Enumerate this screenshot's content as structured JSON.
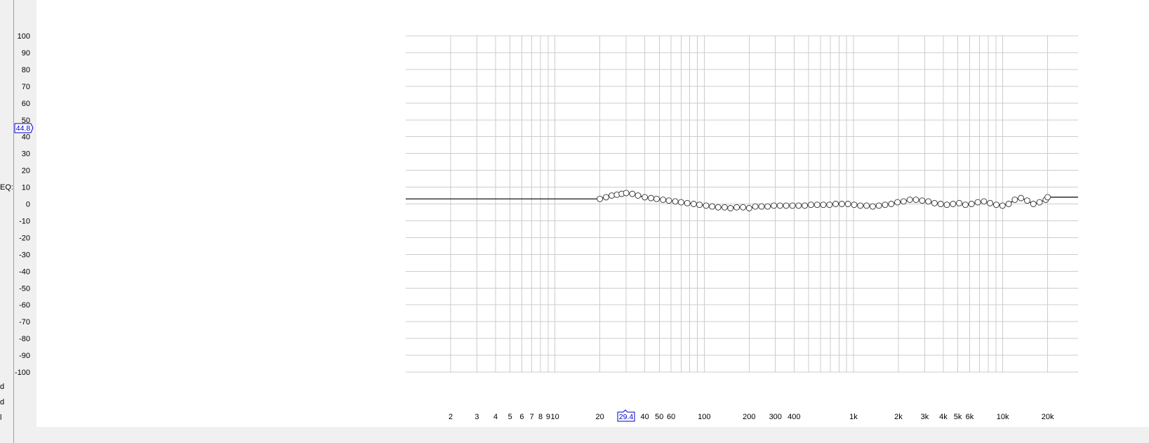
{
  "window": {
    "eq_label": "EQ:",
    "side_labels": [
      "d",
      "d",
      "l"
    ]
  },
  "cursor": {
    "y_readout": "44.8",
    "x_readout": "29.4"
  },
  "colors": {
    "grid": "#cccccc",
    "curve": "#000000",
    "readout_text": "#0000cc",
    "background": "#ffffff"
  },
  "chart_data": {
    "type": "line",
    "x_scale": "log",
    "xlim": [
      1,
      32000
    ],
    "ylim": [
      -100,
      100
    ],
    "y_ticks": [
      100,
      90,
      80,
      70,
      60,
      50,
      40,
      30,
      20,
      10,
      0,
      -10,
      -20,
      -30,
      -40,
      -50,
      -60,
      -70,
      -80,
      -90,
      -100
    ],
    "y_tick_labels": [
      "100",
      "90",
      "80",
      "70",
      "60",
      "50",
      "40",
      "30",
      "20",
      "10",
      "0",
      "-10",
      "-20",
      "-30",
      "-40",
      "-50",
      "-60",
      "-70",
      "-80",
      "-90",
      "-100"
    ],
    "x_ticks": [
      2,
      3,
      4,
      5,
      6,
      7,
      8,
      9,
      10,
      20,
      40,
      50,
      60,
      100,
      200,
      300,
      400,
      1000,
      2000,
      3000,
      4000,
      5000,
      6000,
      10000,
      20000
    ],
    "x_tick_labels": [
      "2",
      "3",
      "4",
      "5",
      "6",
      "7",
      "8",
      "9",
      "10",
      "20",
      "40",
      "50",
      "60",
      "100",
      "200",
      "300",
      "400",
      "1k",
      "2k",
      "3k",
      "4k",
      "5k",
      "6k",
      "10k",
      "20k"
    ],
    "grid_x": [
      2,
      3,
      4,
      5,
      6,
      7,
      8,
      9,
      10,
      20,
      30,
      40,
      50,
      60,
      70,
      80,
      90,
      100,
      200,
      300,
      400,
      500,
      600,
      700,
      800,
      900,
      1000,
      2000,
      3000,
      4000,
      5000,
      6000,
      7000,
      8000,
      9000,
      10000,
      20000
    ],
    "grid": true,
    "series": [
      {
        "x": [
          1,
          20,
          22,
          24,
          26,
          28,
          30,
          33,
          36,
          40,
          44,
          48,
          53,
          58,
          64,
          70,
          77,
          85,
          93,
          103,
          113,
          124,
          137,
          150,
          165,
          182,
          200,
          220,
          242,
          266,
          293,
          322,
          354,
          390,
          429,
          472,
          519,
          571,
          628,
          691,
          760,
          836,
          919,
          1011,
          1112,
          1224,
          1346,
          1481,
          1629,
          1792,
          1971,
          2168,
          2385,
          2623,
          2886,
          3174,
          3492,
          3841,
          4225,
          4648,
          5112,
          5624,
          6186,
          6805,
          7485,
          8234,
          9057,
          9963,
          10959,
          12055,
          13261,
          14587,
          16045,
          17650,
          19415,
          20000,
          32000
        ],
        "y": [
          3,
          3,
          4,
          5,
          5.5,
          6,
          6.5,
          6,
          5,
          4,
          3.5,
          3,
          2.5,
          2,
          1.5,
          1,
          0.5,
          0,
          -0.5,
          -1,
          -1.5,
          -2,
          -2,
          -2.5,
          -2,
          -2,
          -2.5,
          -1.5,
          -1.5,
          -1.5,
          -1,
          -1,
          -1,
          -1,
          -1,
          -1,
          -0.5,
          -0.5,
          -0.5,
          -0.5,
          0,
          0,
          0,
          -0.5,
          -1,
          -1,
          -1.5,
          -1,
          -0.5,
          0,
          1,
          1.5,
          2.5,
          2.5,
          2,
          1.5,
          0.5,
          0,
          -0.5,
          0,
          0.5,
          -0.5,
          0,
          1,
          1.5,
          0.5,
          -0.5,
          -1,
          0,
          2.5,
          3.5,
          2,
          0,
          1,
          2.5,
          4,
          4
        ]
      }
    ]
  }
}
